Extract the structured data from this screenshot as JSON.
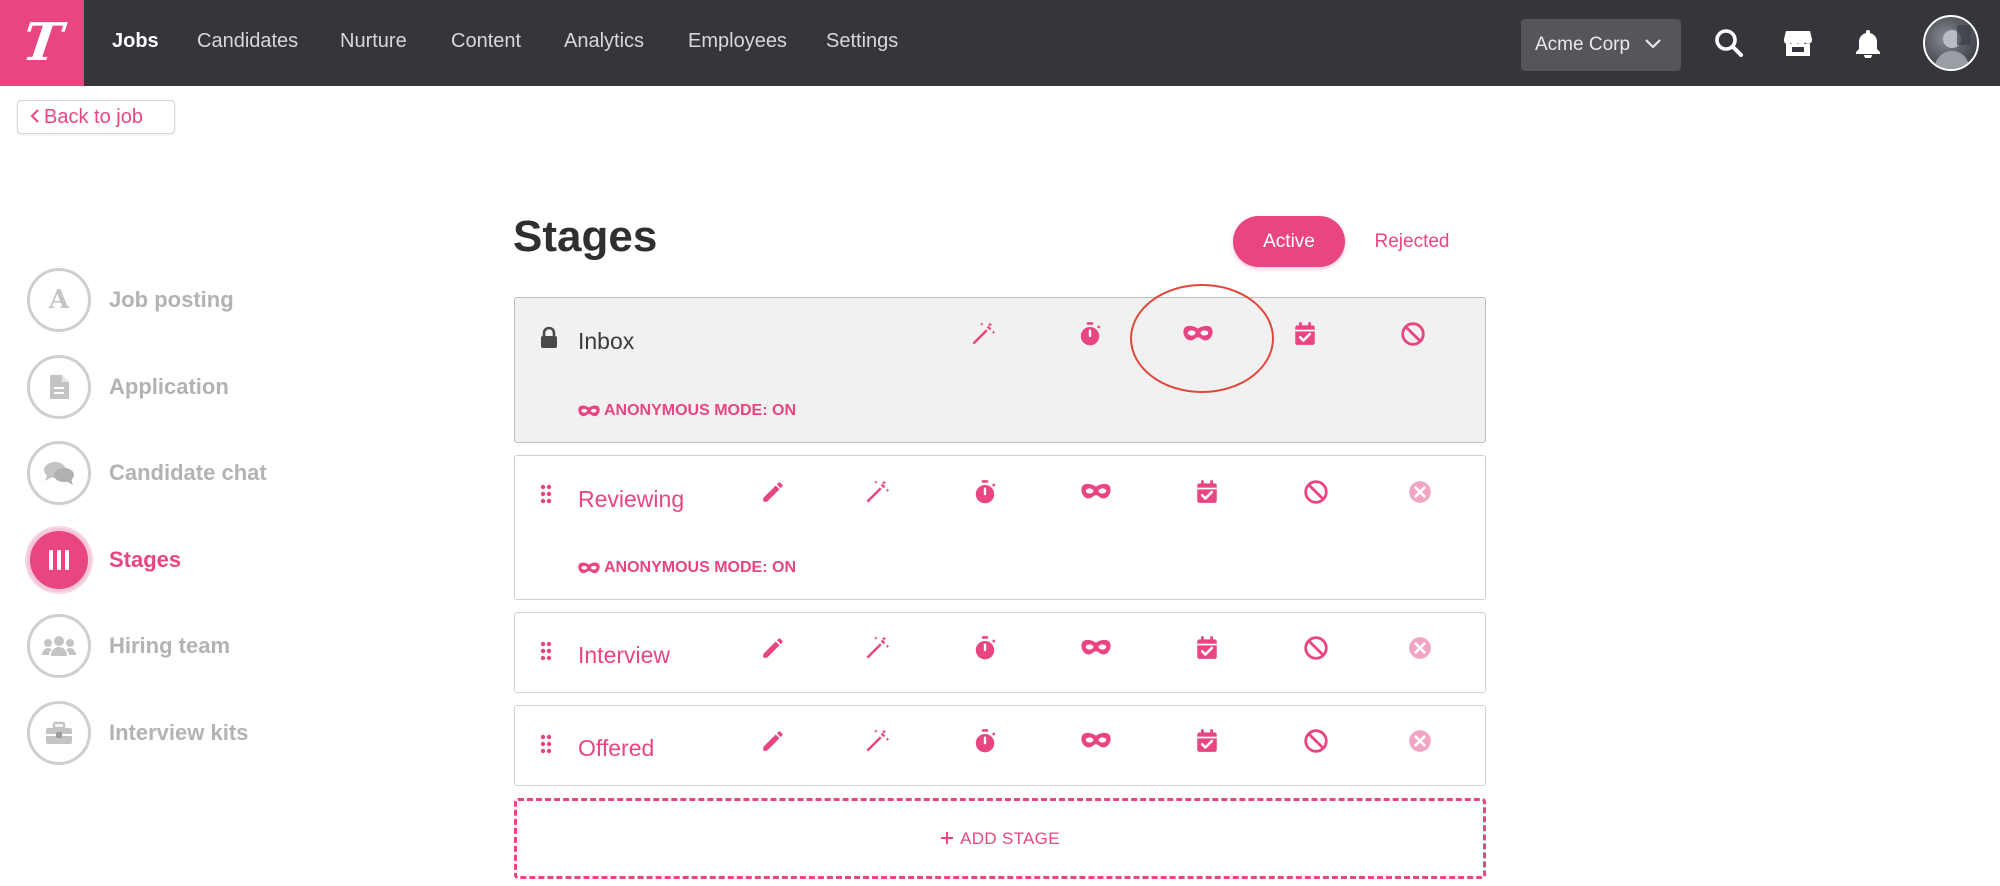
{
  "app": {
    "logo_letter": "T",
    "brand_color": "#e94583"
  },
  "nav": {
    "items": [
      "Jobs",
      "Candidates",
      "Nurture",
      "Content",
      "Analytics",
      "Employees",
      "Settings"
    ],
    "active": "Jobs",
    "company": "Acme Corp"
  },
  "back_label": "Back to job",
  "sidebar": {
    "items": [
      {
        "label": "Job posting",
        "icon": "letter-a-icon"
      },
      {
        "label": "Application",
        "icon": "document-icon"
      },
      {
        "label": "Candidate chat",
        "icon": "chat-bubbles-icon"
      },
      {
        "label": "Stages",
        "icon": "columns-icon",
        "active": true
      },
      {
        "label": "Hiring team",
        "icon": "people-icon"
      },
      {
        "label": "Interview kits",
        "icon": "toolbox-icon"
      }
    ]
  },
  "main": {
    "title": "Stages",
    "toggle": {
      "active_label": "Active",
      "rejected_label": "Rejected"
    },
    "stages": [
      {
        "name": "Inbox",
        "locked": true,
        "anonymous": "ANONYMOUS MODE: ON"
      },
      {
        "name": "Reviewing",
        "locked": false,
        "anonymous": "ANONYMOUS MODE: ON"
      },
      {
        "name": "Interview",
        "locked": false
      },
      {
        "name": "Offered",
        "locked": false
      }
    ],
    "add_stage_label": "ADD STAGE"
  }
}
